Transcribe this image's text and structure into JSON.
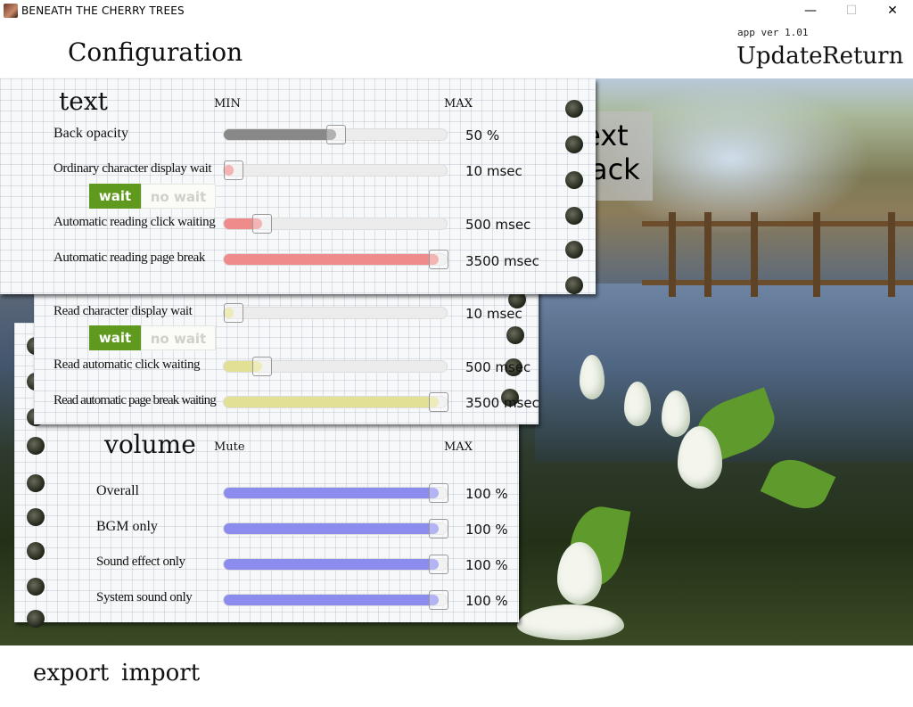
{
  "window": {
    "title": "BENEATH THE CHERRY TREES",
    "minimize": "—",
    "maximize": "☐",
    "close": "✕"
  },
  "header": {
    "title": "Configuration",
    "version": "app ver 1.01",
    "update": "Update",
    "return": "Return"
  },
  "preview": {
    "line1": "Text",
    "line2": "Back"
  },
  "text_section": {
    "title": "text",
    "min_label": "MIN",
    "max_label": "MAX",
    "rows": [
      {
        "label": "Back opacity",
        "value": "50 %",
        "level": 0.5,
        "color": "#888888"
      },
      {
        "label": "Ordinary character display wait",
        "value": "10 msec",
        "level": 0.0,
        "color": "#ee8c8c"
      },
      {
        "label": "Automatic reading click waiting",
        "value": "500 msec",
        "level": 0.14,
        "color": "#ee8c8c"
      },
      {
        "label": "Automatic reading page break",
        "value": "3500 msec",
        "level": 1.0,
        "color": "#ee8c8c"
      }
    ],
    "toggle": {
      "on": "wait",
      "off": "no wait"
    }
  },
  "read_section": {
    "rows": [
      {
        "label": "Read character display wait",
        "value": "10 msec",
        "level": 0.0,
        "color": "#e2e094"
      },
      {
        "label": "Read automatic click waiting",
        "value": "500 msec",
        "level": 0.14,
        "color": "#e2e094"
      },
      {
        "label": "Read automatic page break waiting",
        "value": "3500 msec",
        "level": 1.0,
        "color": "#e2e094"
      }
    ],
    "toggle": {
      "on": "wait",
      "off": "no wait"
    }
  },
  "volume_section": {
    "title": "volume",
    "min_label": "Mute",
    "max_label": "MAX",
    "rows": [
      {
        "label": "Overall",
        "value": "100 %",
        "level": 1.0,
        "color": "#8c8cee"
      },
      {
        "label": "BGM  only",
        "value": "100 %",
        "level": 1.0,
        "color": "#8c8cee"
      },
      {
        "label": "Sound effect only",
        "value": "100 %",
        "level": 1.0,
        "color": "#8c8cee"
      },
      {
        "label": "System sound only",
        "value": "100 %",
        "level": 1.0,
        "color": "#8c8cee"
      }
    ]
  },
  "footer": {
    "export": "export",
    "import": "import"
  }
}
